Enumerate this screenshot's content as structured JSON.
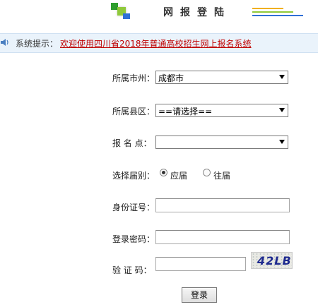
{
  "header": {
    "title": "网报登陆"
  },
  "notice": {
    "label": "系统提示：",
    "text": "欢迎使用四川省2018年普通高校招生网上报名系统"
  },
  "form": {
    "city": {
      "label": "所属市州：",
      "value": "成都市"
    },
    "county": {
      "label": "所属县区：",
      "value": "==请选择=="
    },
    "site": {
      "label": "报 名 点：",
      "value": ""
    },
    "grade": {
      "label": "选择届别：",
      "options": [
        "应届",
        "往届"
      ],
      "selected": "应届"
    },
    "id_number": {
      "label": "身份证号：",
      "value": ""
    },
    "password": {
      "label": "登录密码：",
      "value": ""
    },
    "captcha": {
      "label": "验 证 码：",
      "value": "",
      "image_text": "42LB"
    },
    "submit_label": "登录"
  }
}
